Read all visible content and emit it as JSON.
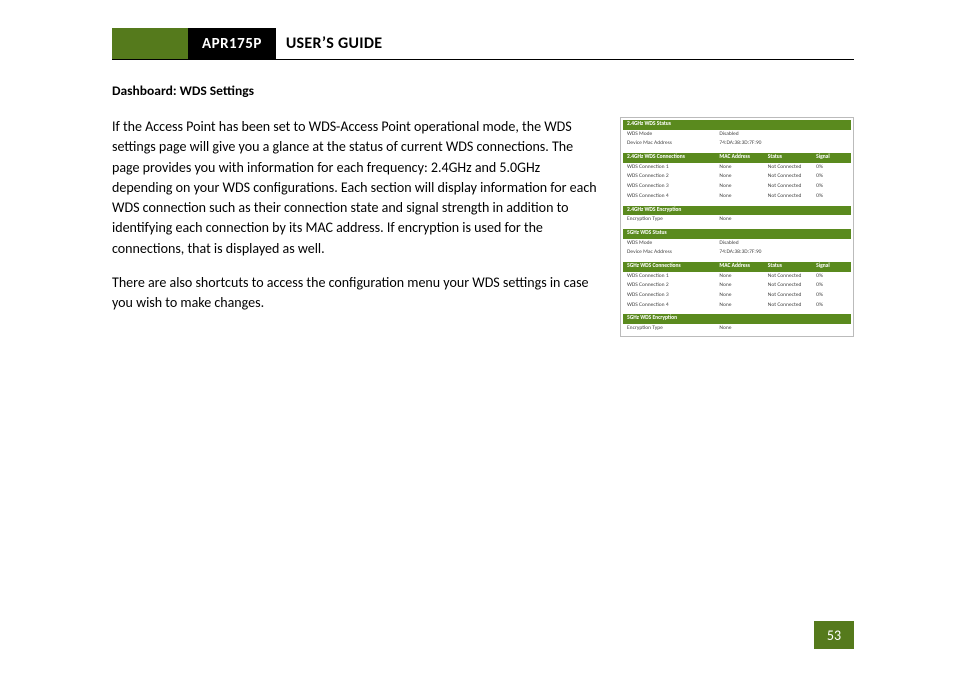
{
  "header": {
    "model": "APR175P",
    "guide": "USER’S GUIDE"
  },
  "section_title": "Dashboard: WDS Settings",
  "paragraphs": [
    "If the Access Point has been set to WDS-Access Point operational mode, the WDS settings page will give you a glance at the status of current WDS connections.  The page provides you with information for each frequency: 2.4GHz and 5.0GHz depending on your WDS configurations.  Each section will display information for each WDS connection such as their connection state and signal strength in addition to identifying each connection by its MAC address.  If encryption is used for the connections, that is displayed as well.",
    "There are also shortcuts to access the configuration menu your WDS settings in case you wish to make changes."
  ],
  "panel": {
    "status24": {
      "title": "2.4GHz WDS Status",
      "rows": [
        {
          "label": "WDS Mode",
          "value": "Disabled"
        },
        {
          "label": "Device Mac Address",
          "value": "74:DA:38:3D:7F:90"
        }
      ]
    },
    "conn24": {
      "title": "2.4GHz WDS Connections",
      "cols": [
        "",
        "MAC Address",
        "Status",
        "Signal"
      ],
      "rows": [
        {
          "c1": "WDS Connection 1",
          "c2": "None",
          "c3": "Not Connected",
          "c4": "0%"
        },
        {
          "c1": "WDS Connection 2",
          "c2": "None",
          "c3": "Not Connected",
          "c4": "0%"
        },
        {
          "c1": "WDS Connection 3",
          "c2": "None",
          "c3": "Not Connected",
          "c4": "0%"
        },
        {
          "c1": "WDS Connection 4",
          "c2": "None",
          "c3": "Not Connected",
          "c4": "0%"
        }
      ]
    },
    "enc24": {
      "title": "2.4GHz WDS Encryption",
      "rows": [
        {
          "label": "Encryption Type",
          "value": "None"
        }
      ]
    },
    "status5": {
      "title": "5GHz WDS Status",
      "rows": [
        {
          "label": "WDS Mode",
          "value": "Disabled"
        },
        {
          "label": "Device Mac Address",
          "value": "74:DA:38:3D:7F:90"
        }
      ]
    },
    "conn5": {
      "title": "5GHz WDS Connections",
      "cols": [
        "",
        "MAC Address",
        "Status",
        "Signal"
      ],
      "rows": [
        {
          "c1": "WDS Connection 1",
          "c2": "None",
          "c3": "Not Connected",
          "c4": "0%"
        },
        {
          "c1": "WDS Connection 2",
          "c2": "None",
          "c3": "Not Connected",
          "c4": "0%"
        },
        {
          "c1": "WDS Connection 3",
          "c2": "None",
          "c3": "Not Connected",
          "c4": "0%"
        },
        {
          "c1": "WDS Connection 4",
          "c2": "None",
          "c3": "Not Connected",
          "c4": "0%"
        }
      ]
    },
    "enc5": {
      "title": "5GHz WDS Encryption",
      "rows": [
        {
          "label": "Encryption Type",
          "value": "None"
        }
      ]
    }
  },
  "page_number": "53"
}
